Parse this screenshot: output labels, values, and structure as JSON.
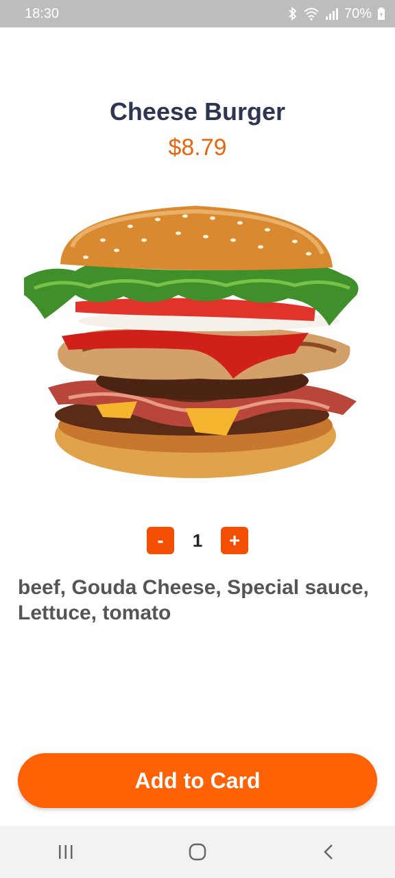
{
  "status_bar": {
    "time": "18:30",
    "battery": "70%",
    "icons": [
      "bluetooth-icon",
      "wifi-icon",
      "signal-icon",
      "battery-icon"
    ]
  },
  "product": {
    "title": "Cheese Burger",
    "price": "$8.79",
    "image": "burger-image",
    "ingredients": "beef, Gouda Cheese, Special sauce, Lettuce, tomato"
  },
  "quantity": {
    "minus_label": "-",
    "value": "1",
    "plus_label": "+"
  },
  "cta": {
    "label": "Add to Card"
  },
  "colors": {
    "accent": "#ff6105",
    "price": "#e8650f",
    "title": "#2d3550",
    "status_bar": "#bdbdbd"
  },
  "nav": {
    "icons": [
      "recent-apps-icon",
      "home-icon",
      "back-icon"
    ]
  }
}
